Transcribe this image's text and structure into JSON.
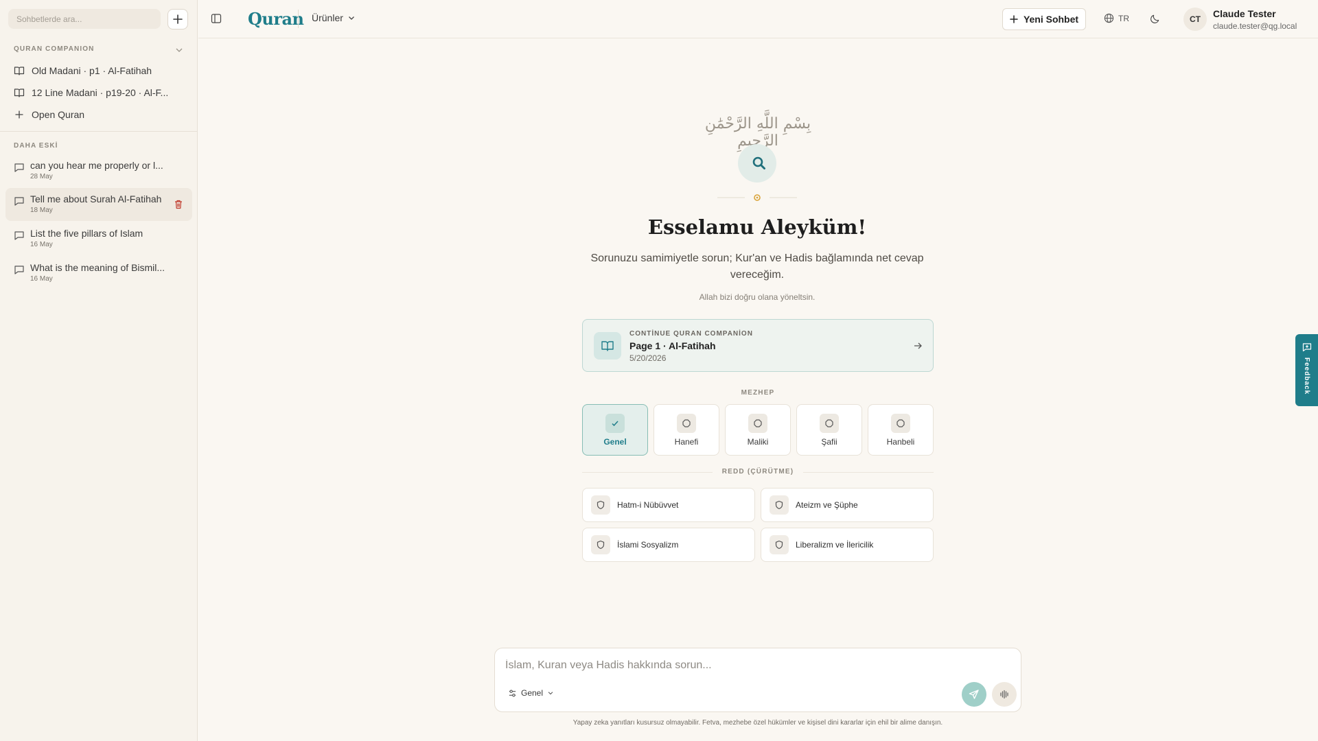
{
  "sidebar": {
    "search_placeholder": "Sohbetlerde ara...",
    "companion_title": "QURAN COMPANION",
    "companion_items": [
      {
        "label": "Old Madani · p1 · Al-Fatihah",
        "icon": "book-icon"
      },
      {
        "label": "12 Line Madani · p19-20 · Al-F...",
        "icon": "book-icon"
      },
      {
        "label": "Open Quran",
        "icon": "plus-icon"
      }
    ],
    "older_title": "DAHA ESKİ",
    "chats": [
      {
        "title": "can you hear me properly or l...",
        "date": "28 May"
      },
      {
        "title": "Tell me about Surah Al-Fatihah",
        "date": "18 May"
      },
      {
        "title": "List the five pillars of Islam",
        "date": "16 May"
      },
      {
        "title": "What is the meaning of Bismil...",
        "date": "16 May"
      }
    ]
  },
  "header": {
    "logo_text": "Quran",
    "products_label": "Ürünler",
    "new_chat_label": "Yeni Sohbet",
    "language": "TR",
    "user_initials": "CT",
    "user_name": "Claude Tester",
    "user_email": "claude.tester@qg.local"
  },
  "main": {
    "bismillah": "بِسْمِ اللَّهِ الرَّحْمَٰنِ الرَّحِيمِ",
    "greeting": "Esselamu Aleyküm!",
    "subtitle": "Sorunuzu samimiyetle sorun; Kur'an ve Hadis bağlamında net cevap vereceğim.",
    "subnote": "Allah bizi doğru olana yöneltsin.",
    "continue_card": {
      "eyebrow": "CONTİNUE QURAN COMPANİON",
      "title": "Page 1 · Al-Fatihah",
      "date": "5/20/2026"
    },
    "mezhep_label": "MEZHEP",
    "mezhep_options": [
      {
        "label": "Genel",
        "selected": true
      },
      {
        "label": "Hanefi",
        "selected": false
      },
      {
        "label": "Maliki",
        "selected": false
      },
      {
        "label": "Şafii",
        "selected": false
      },
      {
        "label": "Hanbeli",
        "selected": false
      }
    ],
    "redd_label": "REDD (ÇÜRÜTME)",
    "redd_options": [
      {
        "label": "Hatm-i Nübüvvet"
      },
      {
        "label": "Ateizm ve Şüphe"
      },
      {
        "label": "İslami Sosyalizm"
      },
      {
        "label": "Liberalizm ve İlericilik"
      }
    ]
  },
  "composer": {
    "placeholder": "İslam, Kuran veya Hadis hakkında sorun...",
    "mode_label": "Genel",
    "disclaimer": "Yapay zeka yanıtları kusursuz olmayabilir. Fetva, mezhebe özel hükümler ve kişisel dini kararlar için ehil bir alime danışın."
  },
  "feedback_label": "Feedback",
  "colors": {
    "accent": "#1f7d8a",
    "background": "#faf7f2",
    "sidebar_bg": "#f7f3ec",
    "delete": "#c0392b",
    "gold": "#d9a43a"
  }
}
